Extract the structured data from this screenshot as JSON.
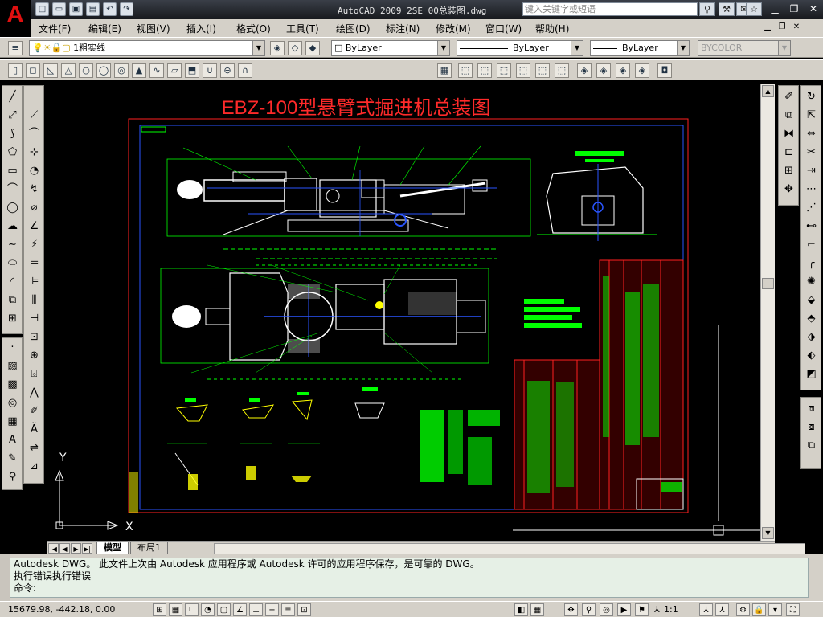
{
  "titlebar": {
    "title": "AutoCAD 2009 2SE 00总装图.dwg",
    "search_placeholder": "键入关键字或短语"
  },
  "menubar": {
    "items": [
      "文件(F)",
      "编辑(E)",
      "视图(V)",
      "插入(I)",
      "格式(O)",
      "工具(T)",
      "绘图(D)",
      "标注(N)",
      "修改(M)",
      "窗口(W)",
      "帮助(H)"
    ]
  },
  "layers_toolbar": {
    "current_layer": "1粗实线",
    "color": "ByLayer",
    "linetype": "ByLayer",
    "lineweight": "ByLayer",
    "plotstyle": "BYCOLOR"
  },
  "drawing": {
    "title": "EBZ-100型悬臂式掘进机总装图",
    "ucs_x": "X",
    "ucs_y": "Y"
  },
  "tabs": {
    "model": "模型",
    "layout1": "布局1"
  },
  "command_window": {
    "line1": "Autodesk DWG。   此文件上次由 Autodesk 应用程序或 Autodesk 许可的应用程序保存，是可靠的 DWG。",
    "line2": "执行错误执行错误",
    "prompt": "命令:"
  },
  "statusbar": {
    "coords": "15679.98, -442.18, 0.00",
    "annotation_scale": "1:1"
  },
  "colors": {
    "drawing_border": "#ff2020",
    "geometry_green": "#00ff00",
    "geometry_white": "#ffffff",
    "geometry_blue": "#2a55ff",
    "geometry_yellow": "#ffff00",
    "title_red": "#ff2a2a"
  }
}
